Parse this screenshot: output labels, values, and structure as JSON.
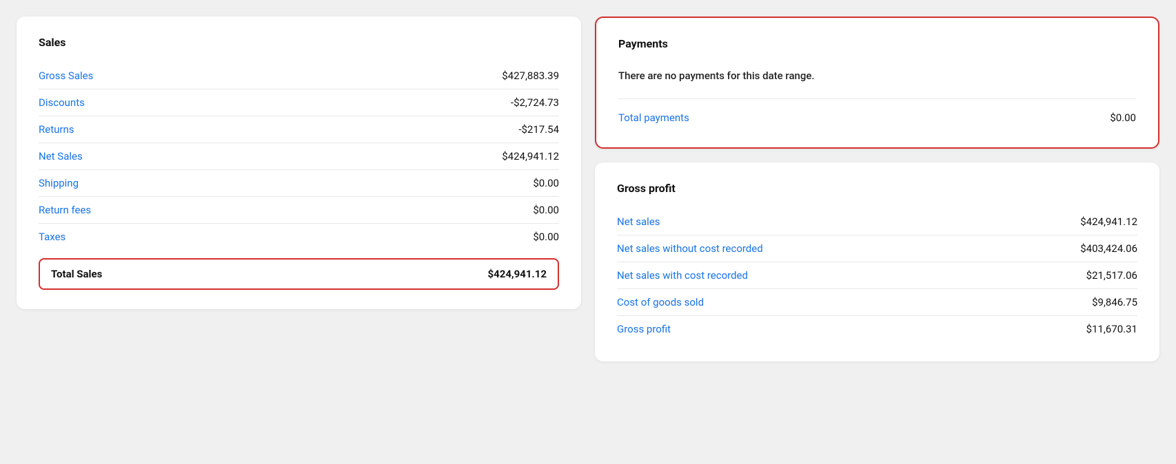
{
  "sales_card": {
    "title": "Sales",
    "items": [
      {
        "label": "Gross Sales",
        "value": "$427,883.39",
        "negative": false
      },
      {
        "label": "Discounts",
        "value": "-$2,724.73",
        "negative": true
      },
      {
        "label": "Returns",
        "value": "-$217.54",
        "negative": true
      },
      {
        "label": "Net Sales",
        "value": "$424,941.12",
        "negative": false
      },
      {
        "label": "Shipping",
        "value": "$0.00",
        "negative": false
      },
      {
        "label": "Return fees",
        "value": "$0.00",
        "negative": false
      },
      {
        "label": "Taxes",
        "value": "$0.00",
        "negative": false
      }
    ],
    "total_label": "Total Sales",
    "total_value": "$424,941.12"
  },
  "payments_card": {
    "title": "Payments",
    "no_payments_text": "There are no payments for this date range.",
    "total_label": "Total payments",
    "total_value": "$0.00"
  },
  "gross_profit_card": {
    "title": "Gross profit",
    "items": [
      {
        "label": "Net sales",
        "value": "$424,941.12"
      },
      {
        "label": "Net sales without cost recorded",
        "value": "$403,424.06"
      },
      {
        "label": "Net sales with cost recorded",
        "value": "$21,517.06"
      },
      {
        "label": "Cost of goods sold",
        "value": "$9,846.75"
      },
      {
        "label": "Gross profit",
        "value": "$11,670.31"
      }
    ]
  }
}
